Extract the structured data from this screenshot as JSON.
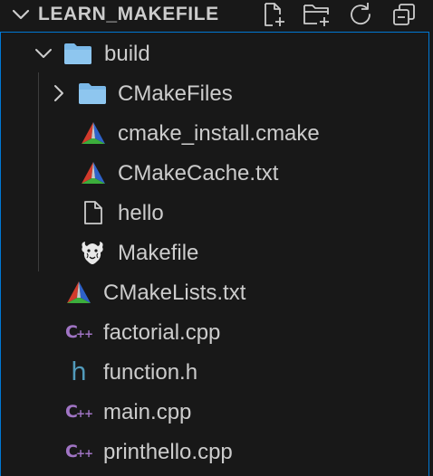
{
  "explorer": {
    "title": "LEARN_MAKEFILE",
    "actions": [
      {
        "name": "new-file-icon"
      },
      {
        "name": "new-folder-icon"
      },
      {
        "name": "refresh-icon"
      },
      {
        "name": "collapse-all-icon"
      }
    ]
  },
  "tree": {
    "build": {
      "label": "build",
      "expanded": true,
      "icon": "folder-icon"
    },
    "cmakefiles": {
      "label": "CMakeFiles",
      "expanded": false,
      "icon": "folder-icon"
    },
    "cmake_install": {
      "label": "cmake_install.cmake",
      "icon": "cmake-icon"
    },
    "cmakecache": {
      "label": "CMakeCache.txt",
      "icon": "cmake-icon"
    },
    "hello": {
      "label": "hello",
      "icon": "file-icon"
    },
    "makefile": {
      "label": "Makefile",
      "icon": "gnu-icon"
    },
    "cmakelists": {
      "label": "CMakeLists.txt",
      "icon": "cmake-icon"
    },
    "factorial": {
      "label": "factorial.cpp",
      "icon": "cpp-icon"
    },
    "function_h": {
      "label": "function.h",
      "icon": "h-icon"
    },
    "main": {
      "label": "main.cpp",
      "icon": "cpp-icon"
    },
    "printhello": {
      "label": "printhello.cpp",
      "icon": "cpp-icon"
    }
  },
  "colors": {
    "background": "#181818",
    "focus_border": "#0078d4",
    "text": "#cccccc",
    "folder": "#7ab8e8",
    "cpp": "#a074c4",
    "header_file": "#519aba"
  },
  "icon_glyphs": {
    "cpp_c": "C",
    "cpp_plus": "++",
    "h": "h"
  }
}
